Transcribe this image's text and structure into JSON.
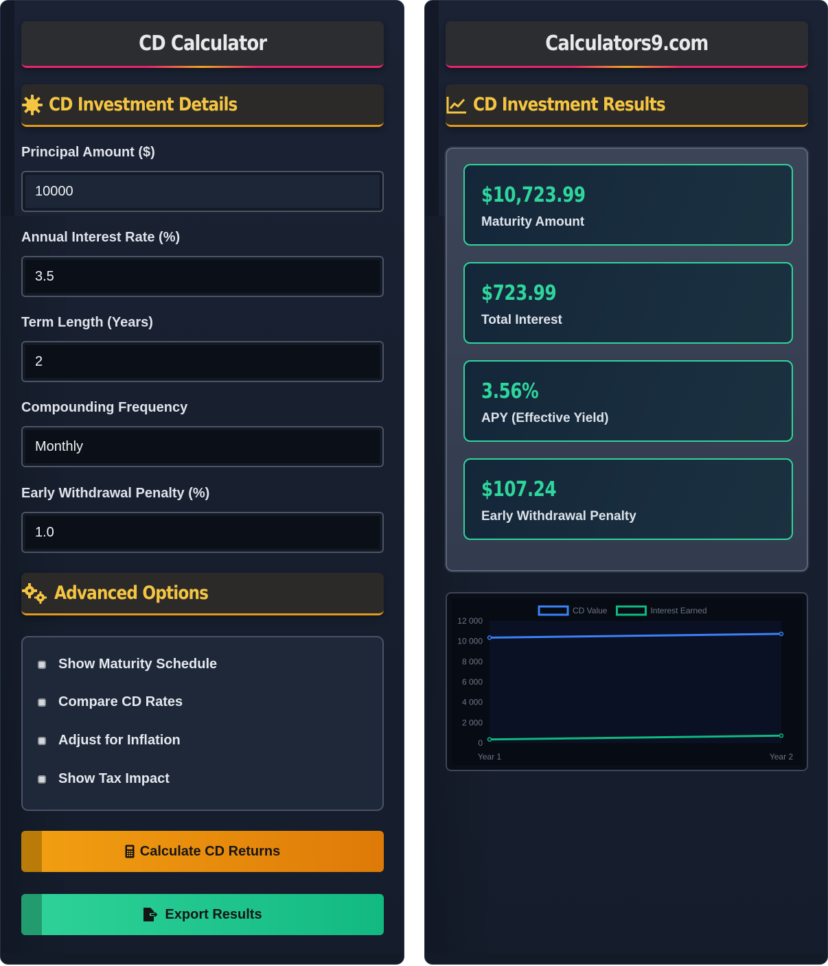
{
  "left": {
    "title": "CD Calculator",
    "details_heading": "CD Investment Details",
    "fields": [
      {
        "label": "Principal Amount ($)",
        "value": "10000"
      },
      {
        "label": "Annual Interest Rate (%)",
        "value": "3.5"
      },
      {
        "label": "Term Length (Years)",
        "value": "2"
      },
      {
        "label": "Compounding Frequency",
        "value": "Monthly"
      },
      {
        "label": "Early Withdrawal Penalty (%)",
        "value": "1.0"
      }
    ],
    "advanced_heading": "Advanced Options",
    "options": [
      {
        "label": "Show Maturity Schedule",
        "checked": false
      },
      {
        "label": "Compare CD Rates",
        "checked": false
      },
      {
        "label": "Adjust for Inflation",
        "checked": false
      },
      {
        "label": "Show Tax Impact",
        "checked": false
      }
    ],
    "calculate_label": "Calculate CD Returns",
    "export_label": "Export Results"
  },
  "right": {
    "title": "Calculators9.com",
    "results_heading": "CD Investment Results",
    "results": [
      {
        "value": "$10,723.99",
        "label": "Maturity Amount"
      },
      {
        "value": "$723.99",
        "label": "Total Interest"
      },
      {
        "value": "3.56%",
        "label": "APY (Effective Yield)"
      },
      {
        "value": "$107.24",
        "label": "Early Withdrawal Penalty"
      }
    ]
  },
  "colors": {
    "accent_gold": "#f5c542",
    "accent_green": "#2fd69c",
    "accent_pink": "#e8246e",
    "orange_button": "#f2a012",
    "green_button": "#12b981",
    "cd_value_line": "#3b82f6",
    "interest_line": "#10b981"
  },
  "icons": {
    "details": "sun-gear-icon",
    "advanced": "gears-icon",
    "results": "line-chart-icon",
    "calculate": "calculator-icon",
    "export": "file-export-icon"
  },
  "chart_data": {
    "type": "line",
    "categories": [
      "Year 1",
      "Year 2"
    ],
    "series": [
      {
        "name": "CD Value",
        "values": [
          10355.99,
          10723.99
        ],
        "color": "#3b82f6"
      },
      {
        "name": "Interest Earned",
        "values": [
          355.99,
          723.99
        ],
        "color": "#10b981"
      }
    ],
    "y_ticks": [
      "0",
      "2 000",
      "4 000",
      "6 000",
      "8 000",
      "10 000",
      "12 000"
    ],
    "ylim": [
      0,
      12000
    ],
    "legend": "top",
    "grid": false
  }
}
